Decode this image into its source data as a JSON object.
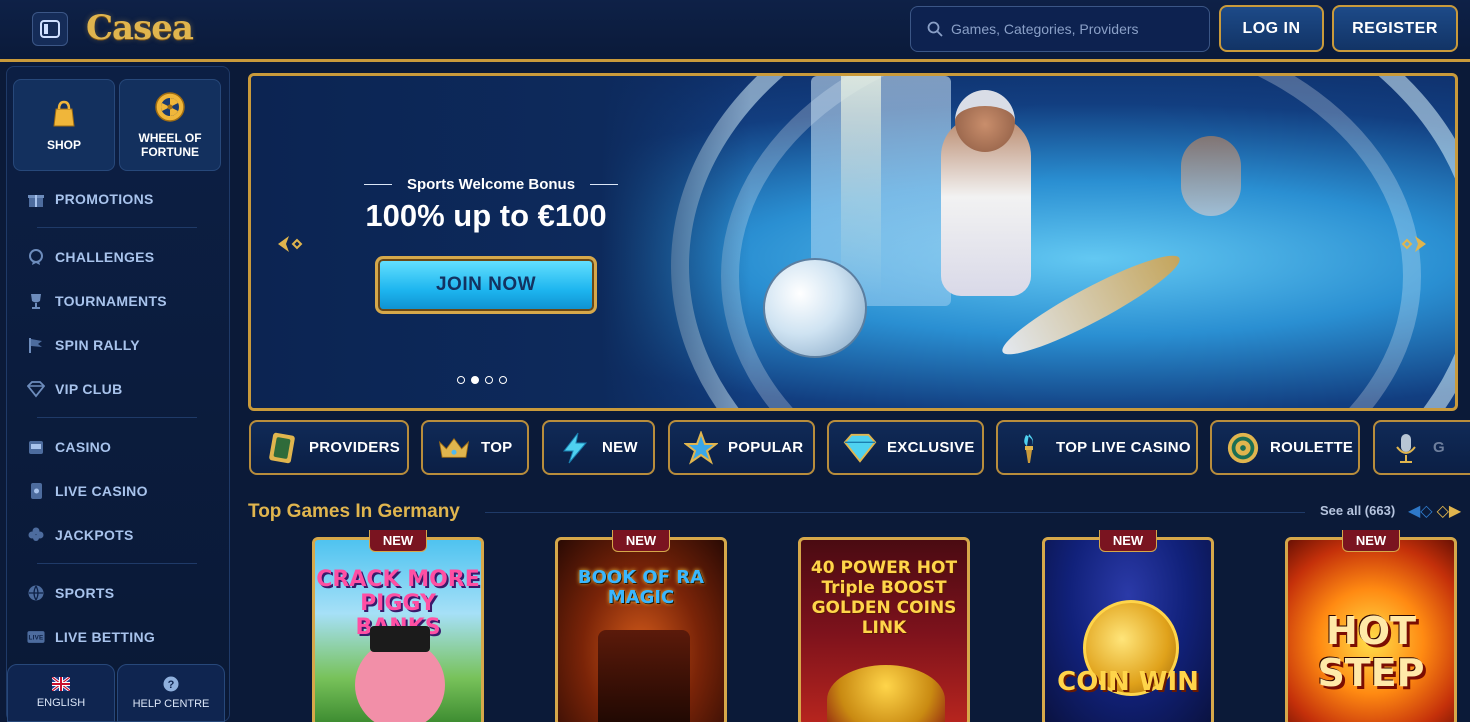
{
  "header": {
    "logo_text": "Casea",
    "search_placeholder": "Games, Categories, Providers",
    "login_label": "LOG IN",
    "register_label": "REGISTER"
  },
  "sidebar": {
    "tiles": [
      {
        "label": "SHOP",
        "icon": "shopping-bag-icon"
      },
      {
        "label": "WHEEL OF FORTUNE",
        "icon": "wheel-icon"
      }
    ],
    "items": [
      {
        "label": "PROMOTIONS",
        "icon": "gift-icon"
      },
      {
        "label": "CHALLENGES",
        "icon": "medal-icon"
      },
      {
        "label": "TOURNAMENTS",
        "icon": "trophy-icon"
      },
      {
        "label": "SPIN RALLY",
        "icon": "flag-icon"
      },
      {
        "label": "VIP CLUB",
        "icon": "diamond-icon"
      },
      {
        "label": "CASINO",
        "icon": "slot-machine-icon"
      },
      {
        "label": "LIVE CASINO",
        "icon": "card-icon"
      },
      {
        "label": "JACKPOTS",
        "icon": "clover-icon"
      },
      {
        "label": "SPORTS",
        "icon": "ball-icon"
      },
      {
        "label": "LIVE BETTING",
        "icon": "live-icon"
      }
    ],
    "language_label": "ENGLISH",
    "help_label": "HELP CENTRE"
  },
  "banner": {
    "subtitle": "Sports Welcome Bonus",
    "title": "100% up to €100",
    "cta": "JOIN NOW",
    "slide_count": 4,
    "active_slide": 2
  },
  "categories": [
    {
      "label": "PROVIDERS",
      "icon": "card-icon"
    },
    {
      "label": "TOP",
      "icon": "crown-icon"
    },
    {
      "label": "NEW",
      "icon": "lightning-icon"
    },
    {
      "label": "POPULAR",
      "icon": "star-icon"
    },
    {
      "label": "EXCLUSIVE",
      "icon": "diamond-icon"
    },
    {
      "label": "TOP LIVE CASINO",
      "icon": "torch-icon"
    },
    {
      "label": "ROULETTE",
      "icon": "roulette-icon"
    },
    {
      "label": "G",
      "icon": "microphone-icon"
    }
  ],
  "section": {
    "title": "Top Games In Germany",
    "see_all": "See all (663)"
  },
  "games": [
    {
      "name": "CRACK MORE PIGGY BANKS",
      "badge": "NEW"
    },
    {
      "name": "BOOK OF RA MAGIC",
      "badge": "NEW"
    },
    {
      "name": "40 POWER HOT Triple BOOST GOLDEN COINS LINK",
      "badge": ""
    },
    {
      "name": "COIN WIN",
      "badge": "NEW"
    },
    {
      "name": "HOT STEP",
      "badge": "NEW"
    }
  ],
  "colors": {
    "gold": "#c99a3b",
    "navy": "#0b1a38",
    "accent_blue": "#1db5ef"
  }
}
